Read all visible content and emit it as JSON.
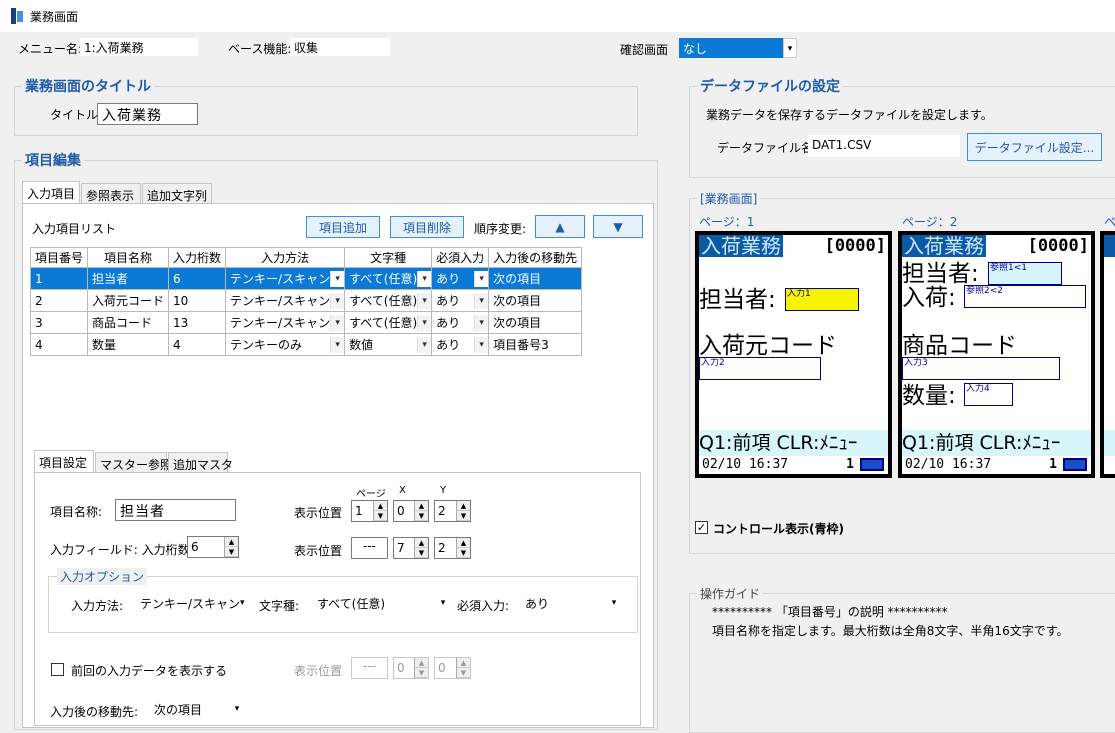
{
  "window": {
    "title": "業務画面"
  },
  "top": {
    "menu_label": "メニュー名:",
    "menu_value": "1:入荷業務",
    "base_label": "ベース機能:",
    "base_value": "収集",
    "confirm_label": "確認画面",
    "confirm_value": "なし"
  },
  "title_group": {
    "heading": "業務画面のタイトル",
    "label": "タイトル:",
    "value": "入荷業務"
  },
  "edit_group": {
    "heading": "項目編集",
    "tabs": [
      "入力項目",
      "参照表示",
      "追加文字列"
    ],
    "list_label": "入力項目リスト",
    "add_button": "項目追加",
    "delete_button": "項目削除",
    "order_label": "順序変更:",
    "up_button": "▲",
    "down_button": "▼",
    "columns": [
      "項目番号",
      "項目名称",
      "入力桁数",
      "入力方法",
      "文字種",
      "必須入力",
      "入力後の移動先"
    ],
    "rows": [
      [
        "1",
        "担当者",
        "6",
        "テンキー/スキャン",
        "すべて(任意)",
        "あり",
        "次の項目"
      ],
      [
        "2",
        "入荷元コード",
        "10",
        "テンキー/スキャン",
        "すべて(任意)",
        "あり",
        "次の項目"
      ],
      [
        "3",
        "商品コード",
        "13",
        "テンキー/スキャン",
        "すべて(任意)",
        "あり",
        "次の項目"
      ],
      [
        "4",
        "数量",
        "4",
        "テンキーのみ",
        "数値",
        "あり",
        "項目番号3"
      ]
    ]
  },
  "item_settings": {
    "tabs": [
      "項目設定",
      "マスター参照",
      "追加マスタ"
    ],
    "name_label": "項目名称:",
    "name_value": "担当者",
    "col_page": "ページ",
    "col_x": "X",
    "col_y": "Y",
    "pos_label": "表示位置",
    "pos1": {
      "page": "1",
      "x": "0",
      "y": "2"
    },
    "field_label": "入力フィールド: 入力桁数",
    "field_digits": "6",
    "pos2": {
      "page": "---",
      "x": "7",
      "y": "2"
    },
    "option_heading": "入力オプション",
    "method_label": "入力方法:",
    "method_value": "テンキー/スキャン",
    "chartype_label": "文字種:",
    "chartype_value": "すべて(任意)",
    "required_label": "必須入力:",
    "required_value": "あり",
    "prev_checkbox": "前回の入力データを表示する",
    "pos3": {
      "page": "---",
      "x": "0",
      "y": "0"
    },
    "next_label": "入力後の移動先:",
    "next_value": "次の項目"
  },
  "data_file": {
    "heading": "データファイルの設定",
    "description": "業務データを保存するデータファイルを設定します。",
    "file_label": "データファイル名:",
    "file_value": "DAT1.CSV",
    "settings_button": "データファイル設定..."
  },
  "preview": {
    "heading": "[業務画面]",
    "pages": [
      "ページ：1",
      "ページ：2",
      "ペ"
    ],
    "screen_title": "入荷業務",
    "screen_code": "[0000]",
    "p1_label1": "担当者:",
    "p1_box1": "入力1",
    "p1_label2": "入荷元コード",
    "p1_box2": "入力2",
    "p2_label1": "担当者:",
    "p2_ref1": "参照1<1",
    "p2_label2": "入荷:",
    "p2_ref2": "参照2<2",
    "p2_label3": "商品コード",
    "p2_box3": "入力3",
    "p2_label4": "数量:",
    "p2_box4": "入力4",
    "footer": "Q1:前項 CLR:ﾒﾆｭｰ",
    "status_time": "02/10 16:37",
    "status_num": "1",
    "control_checkbox": "コントロール表示(青枠)"
  },
  "guide": {
    "heading": "操作ガイド",
    "line1": "********** 「項目番号」の説明 **********",
    "line2": "項目名称を指定します。最大桁数は全角8文字、半角16文字です。"
  }
}
